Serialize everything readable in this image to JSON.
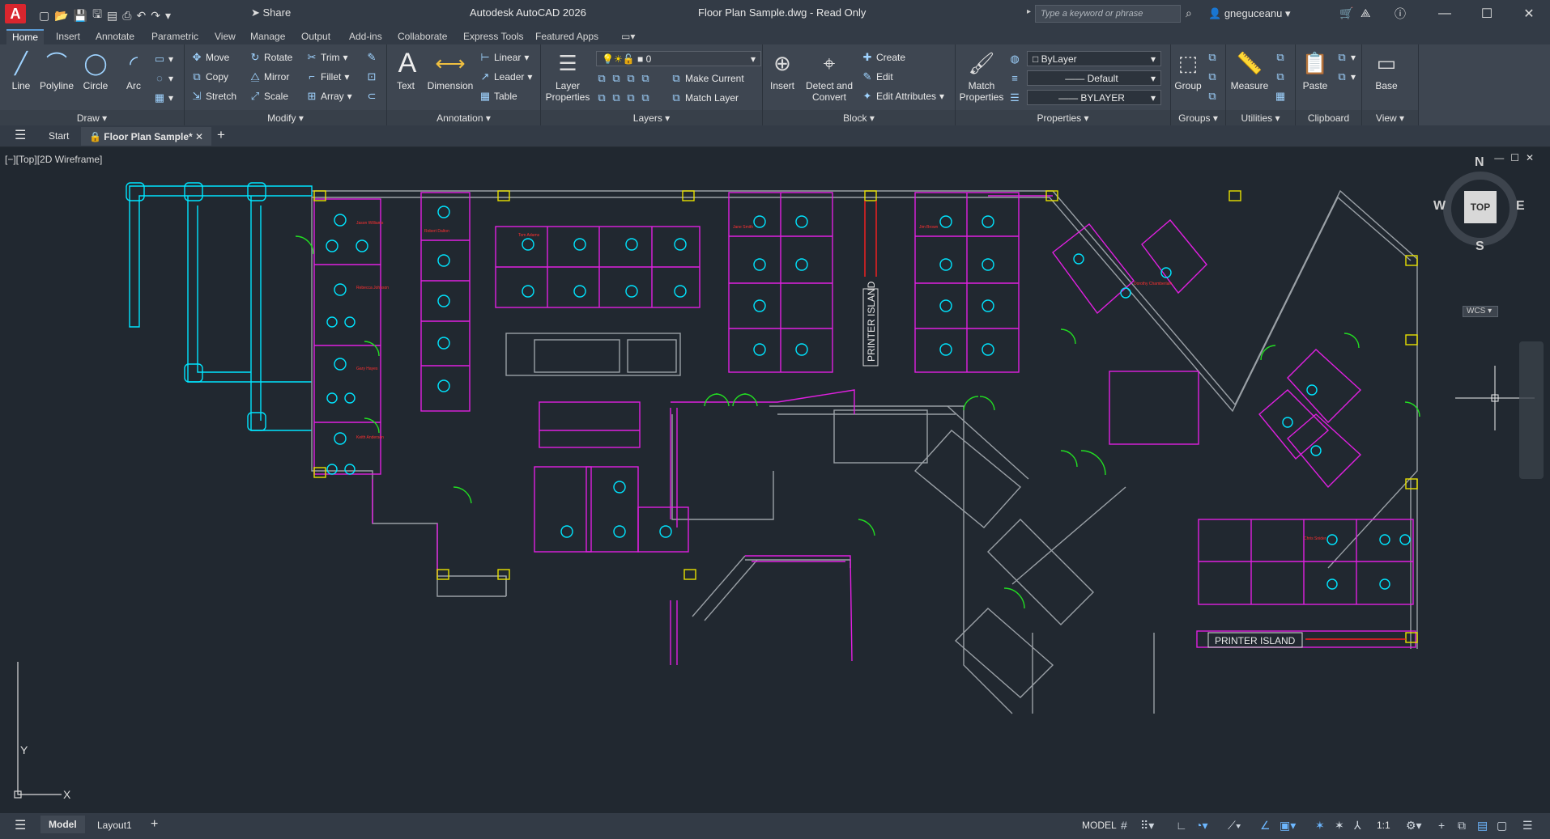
{
  "titlebar": {
    "app_title": "Autodesk AutoCAD 2026",
    "doc_title": "Floor Plan Sample.dwg - Read Only",
    "share_label": "Share",
    "search_placeholder": "Type a keyword or phrase",
    "user_name": "gneguceanu",
    "logo_letter": "A"
  },
  "ribbon_tabs": [
    "Home",
    "Insert",
    "Annotate",
    "Parametric",
    "View",
    "Manage",
    "Output",
    "Add-ins",
    "Collaborate",
    "Express Tools",
    "Featured Apps"
  ],
  "ribbon": {
    "draw": {
      "title": "Draw",
      "line": "Line",
      "polyline": "Polyline",
      "circle": "Circle",
      "arc": "Arc"
    },
    "modify": {
      "title": "Modify",
      "move": "Move",
      "rotate": "Rotate",
      "trim": "Trim",
      "copy": "Copy",
      "mirror": "Mirror",
      "fillet": "Fillet",
      "stretch": "Stretch",
      "scale": "Scale",
      "array": "Array"
    },
    "annotation": {
      "title": "Annotation",
      "text": "Text",
      "dimension": "Dimension",
      "linear": "Linear",
      "leader": "Leader",
      "table": "Table"
    },
    "layers": {
      "title": "Layers",
      "layer_properties": "Layer Properties",
      "current_layer": "0",
      "make_current": "Make Current",
      "match_layer": "Match Layer"
    },
    "block": {
      "title": "Block",
      "insert": "Insert",
      "detect_convert": "Detect and Convert",
      "create": "Create",
      "edit": "Edit",
      "edit_attributes": "Edit Attributes"
    },
    "properties": {
      "title": "Properties",
      "match_properties": "Match Properties",
      "color": "ByLayer",
      "lineweight": "Default",
      "linetype": "BYLAYER"
    },
    "groups": {
      "title": "Groups",
      "group": "Group"
    },
    "utilities": {
      "title": "Utilities",
      "measure": "Measure"
    },
    "clipboard": {
      "title": "Clipboard",
      "paste": "Paste"
    },
    "view": {
      "title": "View",
      "base": "Base"
    }
  },
  "doc_tabs": {
    "start": "Start",
    "active": "Floor Plan Sample*"
  },
  "viewport": {
    "label": "[−][Top][2D Wireframe]",
    "viewcube": {
      "n": "N",
      "s": "S",
      "e": "E",
      "w": "W",
      "top": "TOP",
      "wcs": "WCS"
    },
    "ucs": {
      "y": "Y",
      "x": "X"
    },
    "printer_island_1": "PRINTER ISLAND",
    "printer_island_2": "PRINTER ISLAND"
  },
  "statusbar": {
    "model_tab": "Model",
    "layout_tab": "Layout1",
    "model_label": "MODEL",
    "scale": "1:1"
  },
  "colors": {
    "accent": "#5b9bd5",
    "cyan": "#00e5ff",
    "magenta": "#e020e0",
    "green": "#22dd22",
    "yellow": "#e8e000",
    "red": "#ff2020",
    "grey": "#9aa0a6"
  }
}
